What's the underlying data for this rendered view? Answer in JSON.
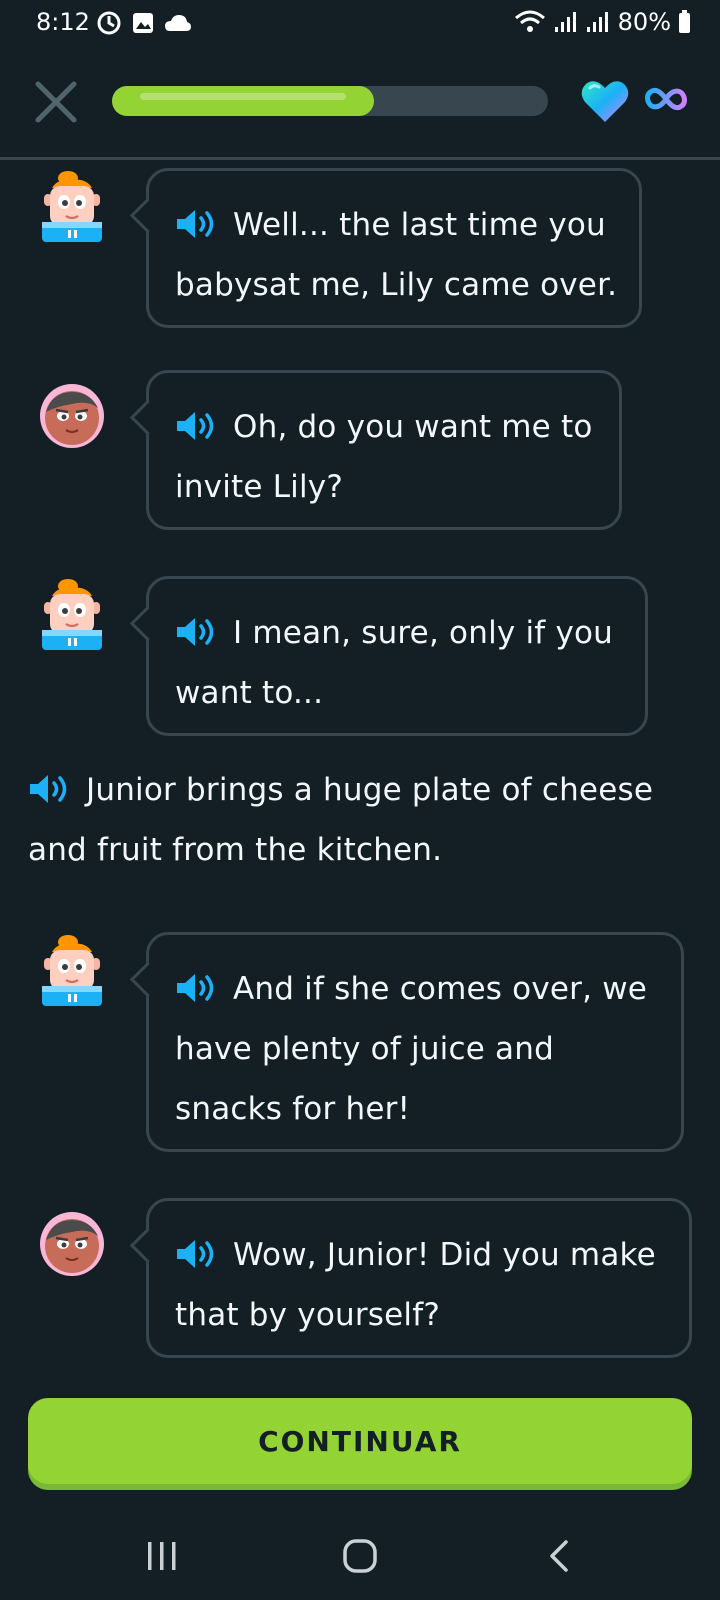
{
  "status_bar": {
    "time": "8:12",
    "battery": "80%"
  },
  "header": {
    "progress": 0.6
  },
  "dialogue": [
    {
      "speaker": "junior",
      "lines": [
        "Well... the last time you",
        "babysat me, Lily came over."
      ]
    },
    {
      "speaker": "woman",
      "lines": [
        "Oh, do you want me to",
        "invite Lily?"
      ]
    },
    {
      "speaker": "junior",
      "lines": [
        "I mean, sure, only if you",
        "want to..."
      ]
    },
    {
      "speaker": "narrator",
      "lines": [
        "Junior brings a huge plate of cheese",
        "and fruit from the kitchen."
      ]
    },
    {
      "speaker": "junior",
      "lines": [
        "And if she comes over, we",
        "have plenty of juice and",
        "snacks for her!"
      ]
    },
    {
      "speaker": "woman",
      "lines": [
        "Wow, Junior! Did you make",
        "that by yourself?"
      ]
    }
  ],
  "footer": {
    "continue_label": "CONTINUAR"
  },
  "colors": {
    "background": "#131f24",
    "accent_green": "#93d333",
    "speaker_blue": "#1cb0f6"
  }
}
